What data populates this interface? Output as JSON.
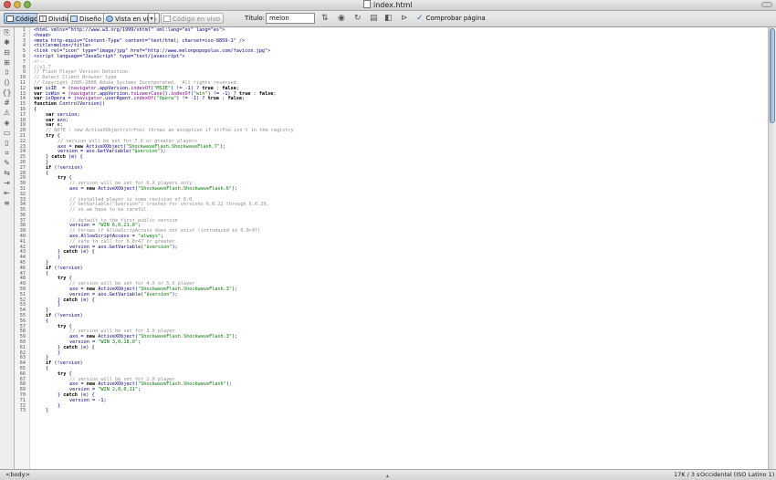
{
  "window": {
    "title": "index.html"
  },
  "toolbar": {
    "code_label": "Código",
    "split_label": "Dividir",
    "design_label": "Diseño",
    "live_view_label": "Vista en vivo",
    "live_code_label": "Código en vivo",
    "title_label": "Título:",
    "title_value": "melon",
    "check_page_label": "Comprobar página"
  },
  "status": {
    "tag": "<body>",
    "size": "17K / 3 s",
    "encoding": "Occidental (ISO Latino 1)"
  },
  "colors": {
    "keyword": "#000000",
    "comment": "#8c8c8c",
    "string": "#007a00",
    "default": "#00007a",
    "function": "#7a007a"
  },
  "code": {
    "lines": [
      {
        "n": "1",
        "ind": 0,
        "seg": [
          [
            "d",
            "<html xmlns=\"http://www.w3.org/1999/xhtml\" xml:lang=\"es\" lang=\"es\">"
          ]
        ]
      },
      {
        "n": "2",
        "ind": 0,
        "seg": [
          [
            "d",
            "<head>"
          ]
        ]
      },
      {
        "n": "3",
        "ind": 0,
        "seg": [
          [
            "d",
            "<meta http-equiv=\"Content-Type\" content=\"text/html; charset=iso-8859-1\" />"
          ]
        ]
      },
      {
        "n": "4",
        "ind": 0,
        "seg": [
          [
            "d",
            "<title>melon</title>"
          ]
        ]
      },
      {
        "n": "5",
        "ind": 0,
        "seg": [
          [
            "d",
            "<link rel=\"icon\" type=\"image/jpg\" href=\"http://www.melonpopopolus.com/favicon.jpg\">"
          ]
        ]
      },
      {
        "n": "6",
        "ind": 0,
        "seg": [
          [
            "d",
            "<script language=\"JavaScript\" type=\"text/javascript\">"
          ]
        ]
      },
      {
        "n": "7",
        "ind": 0,
        "seg": [
          [
            "c",
            "<!--"
          ]
        ]
      },
      {
        "n": "8",
        "ind": 0,
        "seg": [
          [
            "c",
            "//v1.7"
          ]
        ]
      },
      {
        "n": "9",
        "ind": 0,
        "seg": [
          [
            "c",
            "// Flash Player Version Detection"
          ]
        ]
      },
      {
        "n": "10",
        "ind": 0,
        "seg": [
          [
            "c",
            "// Detect Client Browser type"
          ]
        ]
      },
      {
        "n": "11",
        "ind": 0,
        "seg": [
          [
            "c",
            "// Copyright 2005-2008 Adobe Systems Incorporated.  All rights reserved."
          ]
        ]
      },
      {
        "n": "12",
        "ind": 0,
        "seg": [
          [
            "k",
            "var"
          ],
          [
            "d",
            " isIE  = ("
          ],
          [
            "f",
            "navigator"
          ],
          [
            "d",
            ".appVersion."
          ],
          [
            "f",
            "indexOf"
          ],
          [
            "d",
            "("
          ],
          [
            "s",
            "\"MSIE\""
          ],
          [
            "d",
            ") != -1) ? "
          ],
          [
            "k",
            "true"
          ],
          [
            "d",
            " : "
          ],
          [
            "k",
            "false"
          ],
          [
            "d",
            ";"
          ]
        ]
      },
      {
        "n": "13",
        "ind": 0,
        "seg": [
          [
            "k",
            "var"
          ],
          [
            "d",
            " isWin = ("
          ],
          [
            "f",
            "navigator"
          ],
          [
            "d",
            ".appVersion."
          ],
          [
            "f",
            "toLowerCase"
          ],
          [
            "d",
            "()."
          ],
          [
            "f",
            "indexOf"
          ],
          [
            "d",
            "("
          ],
          [
            "s",
            "\"win\""
          ],
          [
            "d",
            ") != -1) ? "
          ],
          [
            "k",
            "true"
          ],
          [
            "d",
            " : "
          ],
          [
            "k",
            "false"
          ],
          [
            "d",
            ";"
          ]
        ]
      },
      {
        "n": "14",
        "ind": 0,
        "seg": [
          [
            "k",
            "var"
          ],
          [
            "d",
            " isOpera = ("
          ],
          [
            "f",
            "navigator"
          ],
          [
            "d",
            ".userAgent."
          ],
          [
            "f",
            "indexOf"
          ],
          [
            "d",
            "("
          ],
          [
            "s",
            "\"Opera\""
          ],
          [
            "d",
            ") != -1) ? "
          ],
          [
            "k",
            "true"
          ],
          [
            "d",
            " : "
          ],
          [
            "k",
            "false"
          ],
          [
            "d",
            ";"
          ]
        ]
      },
      {
        "n": "15",
        "ind": 0,
        "seg": [
          [
            "k",
            "function"
          ],
          [
            "d",
            " ControlVersion()"
          ]
        ]
      },
      {
        "n": "16",
        "ind": 0,
        "seg": [
          [
            "d",
            "{"
          ]
        ]
      },
      {
        "n": "17",
        "ind": 1,
        "seg": [
          [
            "k",
            "var"
          ],
          [
            "d",
            " version;"
          ]
        ]
      },
      {
        "n": "18",
        "ind": 1,
        "seg": [
          [
            "k",
            "var"
          ],
          [
            "d",
            " axo;"
          ]
        ]
      },
      {
        "n": "19",
        "ind": 1,
        "seg": [
          [
            "k",
            "var"
          ],
          [
            "d",
            " e;"
          ]
        ]
      },
      {
        "n": "20",
        "ind": 1,
        "seg": [
          [
            "c",
            "// NOTE : new ActiveXObject(strFoo) throws an exception if strFoo isn't in the registry"
          ]
        ]
      },
      {
        "n": "21",
        "ind": 1,
        "seg": [
          [
            "k",
            "try"
          ],
          [
            "d",
            " {"
          ]
        ]
      },
      {
        "n": "22",
        "ind": 2,
        "seg": [
          [
            "c",
            "// version will be set for 7.X or greater players"
          ]
        ]
      },
      {
        "n": "23",
        "ind": 2,
        "seg": [
          [
            "d",
            "axo = "
          ],
          [
            "k",
            "new"
          ],
          [
            "d",
            " ActiveXObject("
          ],
          [
            "s",
            "\"ShockwaveFlash.ShockwaveFlash.7\""
          ],
          [
            "d",
            ");"
          ]
        ]
      },
      {
        "n": "24",
        "ind": 2,
        "seg": [
          [
            "d",
            "version = axo.GetVariable("
          ],
          [
            "s",
            "\"$version\""
          ],
          [
            "d",
            ");"
          ]
        ]
      },
      {
        "n": "25",
        "ind": 1,
        "seg": [
          [
            "d",
            "} "
          ],
          [
            "k",
            "catch"
          ],
          [
            "d",
            " (e) {"
          ]
        ]
      },
      {
        "n": "26",
        "ind": 1,
        "seg": [
          [
            "d",
            "}"
          ]
        ]
      },
      {
        "n": "27",
        "ind": 1,
        "seg": [
          [
            "k",
            "if"
          ],
          [
            "d",
            " (!version)"
          ]
        ]
      },
      {
        "n": "28",
        "ind": 1,
        "seg": [
          [
            "d",
            "{"
          ]
        ]
      },
      {
        "n": "29",
        "ind": 2,
        "seg": [
          [
            "k",
            "try"
          ],
          [
            "d",
            " {"
          ]
        ]
      },
      {
        "n": "30",
        "ind": 3,
        "seg": [
          [
            "c",
            "// version will be set for 6.X players only"
          ]
        ]
      },
      {
        "n": "31",
        "ind": 3,
        "seg": [
          [
            "d",
            "axo = "
          ],
          [
            "k",
            "new"
          ],
          [
            "d",
            " ActiveXObject("
          ],
          [
            "s",
            "\"ShockwaveFlash.ShockwaveFlash.6\""
          ],
          [
            "d",
            ");"
          ]
        ]
      },
      {
        "n": "32",
        "ind": 0,
        "seg": []
      },
      {
        "n": "33",
        "ind": 3,
        "seg": [
          [
            "c",
            "// installed player is some revision of 6.0"
          ]
        ]
      },
      {
        "n": "34",
        "ind": 3,
        "seg": [
          [
            "c",
            "// GetVariable(\"$version\") crashes for versions 6.0.22 through 6.0.29,"
          ]
        ]
      },
      {
        "n": "35",
        "ind": 3,
        "seg": [
          [
            "c",
            "// so we have to be careful."
          ]
        ]
      },
      {
        "n": "36",
        "ind": 0,
        "seg": []
      },
      {
        "n": "37",
        "ind": 3,
        "seg": [
          [
            "c",
            "// default to the first public version"
          ]
        ]
      },
      {
        "n": "38",
        "ind": 3,
        "seg": [
          [
            "d",
            "version = "
          ],
          [
            "s",
            "\"WIN 6,0,21,0\""
          ],
          [
            "d",
            ";"
          ]
        ]
      },
      {
        "n": "39",
        "ind": 3,
        "seg": [
          [
            "c",
            "// throws if AllowScripAccess does not exist (introduced in 6.0r47)"
          ]
        ]
      },
      {
        "n": "40",
        "ind": 3,
        "seg": [
          [
            "d",
            "axo.AllowScriptAccess = "
          ],
          [
            "s",
            "\"always\""
          ],
          [
            "d",
            ";"
          ]
        ]
      },
      {
        "n": "41",
        "ind": 3,
        "seg": [
          [
            "c",
            "// safe to call for 6.0r47 or greater"
          ]
        ]
      },
      {
        "n": "42",
        "ind": 3,
        "seg": [
          [
            "d",
            "version = axo.GetVariable("
          ],
          [
            "s",
            "\"$version\""
          ],
          [
            "d",
            ");"
          ]
        ]
      },
      {
        "n": "43",
        "ind": 2,
        "seg": [
          [
            "d",
            "} "
          ],
          [
            "k",
            "catch"
          ],
          [
            "d",
            " (e) {"
          ]
        ]
      },
      {
        "n": "44",
        "ind": 2,
        "seg": [
          [
            "d",
            "}"
          ]
        ]
      },
      {
        "n": "45",
        "ind": 1,
        "seg": [
          [
            "d",
            "}"
          ]
        ]
      },
      {
        "n": "46",
        "ind": 1,
        "seg": [
          [
            "k",
            "if"
          ],
          [
            "d",
            " (!version)"
          ]
        ]
      },
      {
        "n": "47",
        "ind": 1,
        "seg": [
          [
            "d",
            "{"
          ]
        ]
      },
      {
        "n": "48",
        "ind": 2,
        "seg": [
          [
            "k",
            "try"
          ],
          [
            "d",
            " {"
          ]
        ]
      },
      {
        "n": "49",
        "ind": 3,
        "seg": [
          [
            "c",
            "// version will be set for 4.X or 5.X player"
          ]
        ]
      },
      {
        "n": "50",
        "ind": 3,
        "seg": [
          [
            "d",
            "axo = "
          ],
          [
            "k",
            "new"
          ],
          [
            "d",
            " ActiveXObject("
          ],
          [
            "s",
            "\"ShockwaveFlash.ShockwaveFlash.3\""
          ],
          [
            "d",
            ");"
          ]
        ]
      },
      {
        "n": "51",
        "ind": 3,
        "seg": [
          [
            "d",
            "version = axo.GetVariable("
          ],
          [
            "s",
            "\"$version\""
          ],
          [
            "d",
            ");"
          ]
        ]
      },
      {
        "n": "52",
        "ind": 2,
        "seg": [
          [
            "d",
            "} "
          ],
          [
            "k",
            "catch"
          ],
          [
            "d",
            " (e) {"
          ]
        ]
      },
      {
        "n": "53",
        "ind": 2,
        "seg": [
          [
            "d",
            "}"
          ]
        ]
      },
      {
        "n": "54",
        "ind": 1,
        "seg": [
          [
            "d",
            "}"
          ]
        ]
      },
      {
        "n": "55",
        "ind": 1,
        "seg": [
          [
            "k",
            "if"
          ],
          [
            "d",
            " (!version)"
          ]
        ]
      },
      {
        "n": "56",
        "ind": 1,
        "seg": [
          [
            "d",
            "{"
          ]
        ]
      },
      {
        "n": "57",
        "ind": 2,
        "seg": [
          [
            "k",
            "try"
          ],
          [
            "d",
            " {"
          ]
        ]
      },
      {
        "n": "58",
        "ind": 3,
        "seg": [
          [
            "c",
            "// version will be set for 3.X player"
          ]
        ]
      },
      {
        "n": "59",
        "ind": 3,
        "seg": [
          [
            "d",
            "axo = "
          ],
          [
            "k",
            "new"
          ],
          [
            "d",
            " ActiveXObject("
          ],
          [
            "s",
            "\"ShockwaveFlash.ShockwaveFlash.3\""
          ],
          [
            "d",
            ");"
          ]
        ]
      },
      {
        "n": "60",
        "ind": 3,
        "seg": [
          [
            "d",
            "version = "
          ],
          [
            "s",
            "\"WIN 3,0,18,0\""
          ],
          [
            "d",
            ";"
          ]
        ]
      },
      {
        "n": "61",
        "ind": 2,
        "seg": [
          [
            "d",
            "} "
          ],
          [
            "k",
            "catch"
          ],
          [
            "d",
            " (e) {"
          ]
        ]
      },
      {
        "n": "62",
        "ind": 2,
        "seg": [
          [
            "d",
            "}"
          ]
        ]
      },
      {
        "n": "63",
        "ind": 1,
        "seg": [
          [
            "d",
            "}"
          ]
        ]
      },
      {
        "n": "64",
        "ind": 1,
        "seg": [
          [
            "k",
            "if"
          ],
          [
            "d",
            " (!version)"
          ]
        ]
      },
      {
        "n": "65",
        "ind": 1,
        "seg": [
          [
            "d",
            "{"
          ]
        ]
      },
      {
        "n": "66",
        "ind": 2,
        "seg": [
          [
            "k",
            "try"
          ],
          [
            "d",
            " {"
          ]
        ]
      },
      {
        "n": "67",
        "ind": 3,
        "seg": [
          [
            "c",
            "// version will be set for 2.X player"
          ]
        ]
      },
      {
        "n": "68",
        "ind": 3,
        "seg": [
          [
            "d",
            "axo = "
          ],
          [
            "k",
            "new"
          ],
          [
            "d",
            " ActiveXObject("
          ],
          [
            "s",
            "\"ShockwaveFlash.ShockwaveFlash\""
          ],
          [
            "d",
            ");"
          ]
        ]
      },
      {
        "n": "69",
        "ind": 3,
        "seg": [
          [
            "d",
            "version = "
          ],
          [
            "s",
            "\"WIN 2,0,0,11\""
          ],
          [
            "d",
            ";"
          ]
        ]
      },
      {
        "n": "70",
        "ind": 2,
        "seg": [
          [
            "d",
            "} "
          ],
          [
            "k",
            "catch"
          ],
          [
            "d",
            " (e) {"
          ]
        ]
      },
      {
        "n": "71",
        "ind": 3,
        "seg": [
          [
            "d",
            "version = -1;"
          ]
        ]
      },
      {
        "n": "72",
        "ind": 2,
        "seg": [
          [
            "d",
            "}"
          ]
        ]
      },
      {
        "n": "73",
        "ind": 1,
        "seg": [
          [
            "d",
            "}"
          ]
        ]
      }
    ]
  }
}
